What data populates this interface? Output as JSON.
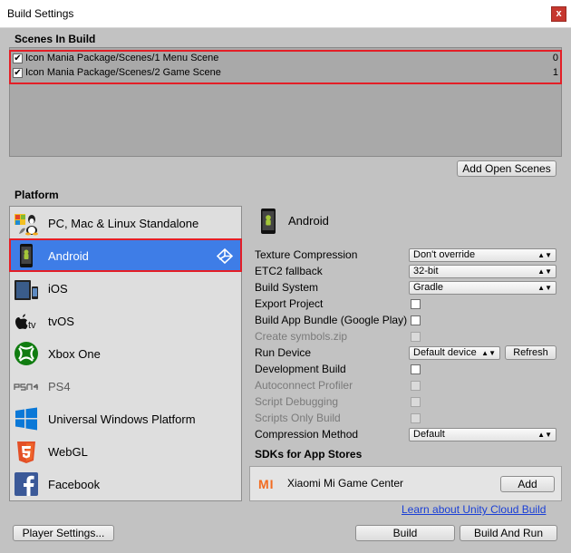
{
  "window": {
    "title": "Build Settings",
    "close_label": "x"
  },
  "scenes": {
    "section_label": "Scenes In Build",
    "items": [
      {
        "checked": "✔",
        "path": "Icon Mania Package/Scenes/1 Menu Scene",
        "index": "0"
      },
      {
        "checked": "✔",
        "path": "Icon Mania Package/Scenes/2 Game Scene",
        "index": "1"
      }
    ],
    "add_open_scenes": "Add Open Scenes"
  },
  "platform": {
    "section_label": "Platform",
    "items": [
      {
        "label": "PC, Mac & Linux Standalone",
        "icon": "pc-mac-linux-icon"
      },
      {
        "label": "Android",
        "icon": "android-icon",
        "selected": true
      },
      {
        "label": "iOS",
        "icon": "ios-icon"
      },
      {
        "label": "tvOS",
        "icon": "tvos-icon"
      },
      {
        "label": "Xbox One",
        "icon": "xbox-icon"
      },
      {
        "label": "PS4",
        "icon": "ps4-icon",
        "disabled": true
      },
      {
        "label": "Universal Windows Platform",
        "icon": "windows-icon"
      },
      {
        "label": "WebGL",
        "icon": "html5-icon"
      },
      {
        "label": "Facebook",
        "icon": "facebook-icon"
      }
    ]
  },
  "settings": {
    "title": "Android",
    "texture_compression": {
      "label": "Texture Compression",
      "value": "Don't override"
    },
    "etc2_fallback": {
      "label": "ETC2 fallback",
      "value": "32-bit"
    },
    "build_system": {
      "label": "Build System",
      "value": "Gradle"
    },
    "export_project": {
      "label": "Export Project"
    },
    "build_app_bundle": {
      "label": "Build App Bundle (Google Play)"
    },
    "create_symbols": {
      "label": "Create symbols.zip"
    },
    "run_device": {
      "label": "Run Device",
      "value": "Default device",
      "refresh": "Refresh"
    },
    "development_build": {
      "label": "Development Build"
    },
    "autoconnect_profiler": {
      "label": "Autoconnect Profiler"
    },
    "script_debugging": {
      "label": "Script Debugging"
    },
    "scripts_only_build": {
      "label": "Scripts Only Build"
    },
    "compression_method": {
      "label": "Compression Method",
      "value": "Default"
    }
  },
  "sdks": {
    "section_label": "SDKs for App Stores",
    "item_logo": "MI",
    "item_name": "Xiaomi Mi Game Center",
    "add_label": "Add",
    "cloud_link": "Learn about Unity Cloud Build"
  },
  "footer": {
    "player_settings": "Player Settings...",
    "build": "Build",
    "build_and_run": "Build And Run"
  },
  "colors": {
    "selected": "#3e7de7",
    "highlight": "#e41e26",
    "mi_orange": "#f26c21",
    "facebook_blue": "#3b5998",
    "xbox_green": "#107c10",
    "windows_blue": "#0a78d7",
    "html5_orange": "#e34f26"
  }
}
